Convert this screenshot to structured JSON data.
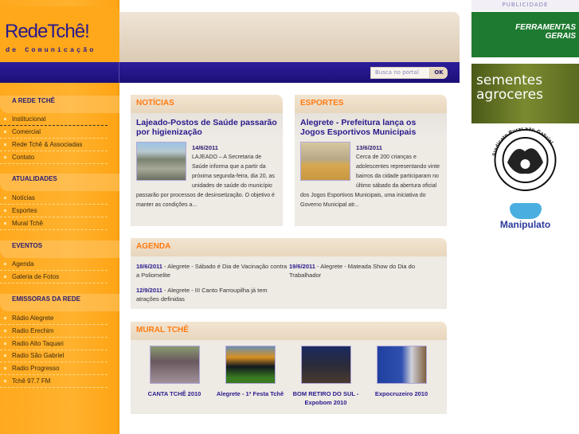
{
  "logo": {
    "brand": "RedeTchê!",
    "tagline": "de Comunicação"
  },
  "search": {
    "placeholder": "Busca no portal",
    "button": "OK"
  },
  "sidebar": {
    "sections": [
      {
        "title": "A REDE TCHÊ",
        "items": [
          "Institucional",
          "Comercial",
          "Rede Tchê & Associadas",
          "Contato"
        ]
      },
      {
        "title": "ATUALIDADES",
        "items": [
          "Notícias",
          "Esportes",
          "Mural Tchê"
        ]
      },
      {
        "title": "EVENTOS",
        "items": [
          "Agenda",
          "Galeria de Fotos"
        ]
      },
      {
        "title": "EMISSORAS DA REDE",
        "items": [
          "Rádio Alegrete",
          "Radio Erechim",
          "Radio Alto Taquari",
          "Radio São Gabriel",
          "Radio Progresso",
          "Tchê 97.7 FM"
        ]
      }
    ]
  },
  "noticias": {
    "title": "NOTÍCIAS",
    "headline": "Lajeado-Postos de Saúde passarão por higienização",
    "date": "14/6/2011",
    "text": "LAJEADO – A Secretaria de Saúde informa que a partir da próxima segunda-feira, dia 20, as unidades de saúde do município passarão por processos de desinsetização. O objetivo é manter as condições a..."
  },
  "esportes": {
    "title": "ESPORTES",
    "headline": "Alegrete - Prefeitura lança os Jogos Esportivos Municipais",
    "date": "13/6/2011",
    "text": "Cerca de 200 crianças e adolescentes representando vinte bairros da cidade participaram no último sábado da abertura oficial dos Jogos Esportivos Municipais, uma iniciativa do Governo Municipal atr..."
  },
  "agenda": {
    "title": "AGENDA",
    "items": [
      {
        "date": "18/6/2011",
        "text": " - Alegrete - Sábado é Dia de Vacinação contra a Poliomelite"
      },
      {
        "date": "19/6/2011",
        "text": " - Alegrete - Mateada Show do Dia do Trabalhador"
      },
      {
        "date": "12/9/2011",
        "text": " - Alegrete - III Canto Farroupilha já tem atrações definidas"
      }
    ]
  },
  "mural": {
    "title": "MURAL TCHÊ",
    "items": [
      "CANTA TCHÊ 2010",
      "Alegrete - 1ª Festa Tchê",
      "BOM RETIRO DO SUL -Expobom 2010",
      "Expocruzeiro 2010"
    ]
  },
  "publicidade": {
    "label": "PUBLICIDADE",
    "ads": [
      "FERRAMENTAS GERAIS",
      "sementes agroceres",
      "Sindicato Rural São Gabriel",
      "Manipulato"
    ]
  },
  "colors": {
    "orange": "#ffa91e",
    "navy": "#2a1a8c",
    "accent": "#ff7a10"
  }
}
